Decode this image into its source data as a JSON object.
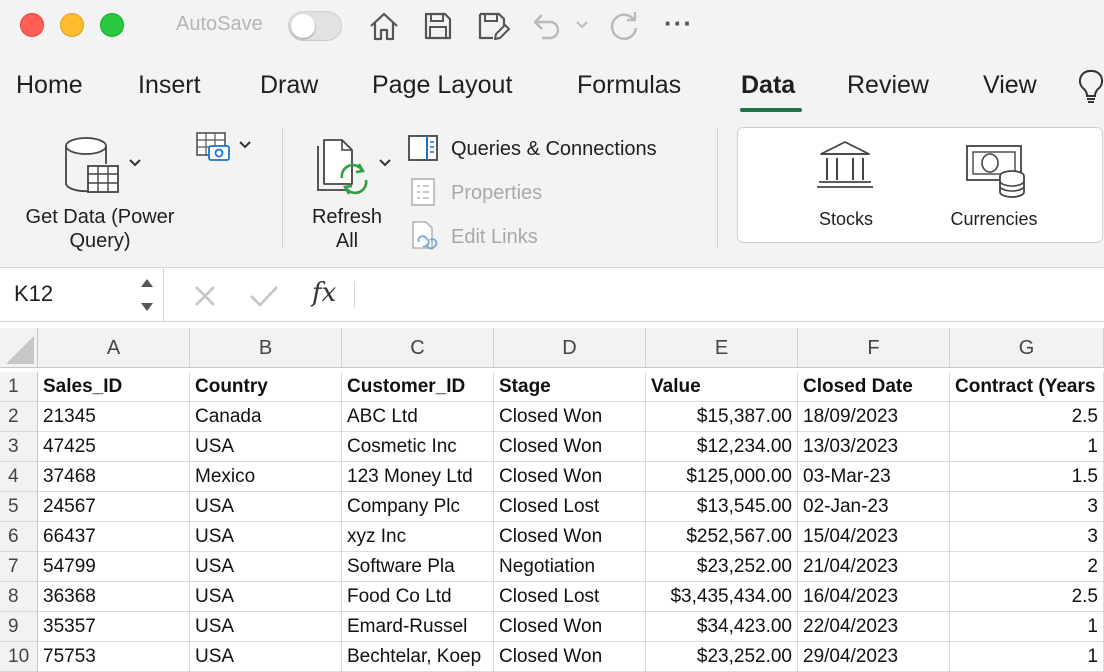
{
  "title_bar": {
    "autosave_label": "AutoSave",
    "autosave_on": false,
    "traffic_lights": {
      "close": "#ff5f57",
      "minimize": "#febc2e",
      "zoom": "#28c840"
    },
    "icons": [
      "home-icon",
      "save-icon",
      "save-as-icon",
      "undo-icon",
      "redo-icon",
      "more-icon"
    ],
    "more_label": "···"
  },
  "tabs": [
    {
      "label": "Home",
      "active": false
    },
    {
      "label": "Insert",
      "active": false
    },
    {
      "label": "Draw",
      "active": false
    },
    {
      "label": "Page Layout",
      "active": false
    },
    {
      "label": "Formulas",
      "active": false
    },
    {
      "label": "Data",
      "active": true
    },
    {
      "label": "Review",
      "active": false
    },
    {
      "label": "View",
      "active": false
    }
  ],
  "tell_me_icon": "lightbulb-icon",
  "accent_color": "#1e7145",
  "ribbon": {
    "get_data": {
      "line1": "Get Data (Power",
      "line2": "Query)"
    },
    "refresh": {
      "line1": "Refresh",
      "line2": "All"
    },
    "queries_connections": "Queries & Connections",
    "properties": "Properties",
    "edit_links": "Edit Links",
    "stocks": "Stocks",
    "currencies": "Currencies"
  },
  "formula_bar": {
    "name_box": "K12",
    "fx_label": "fx",
    "formula": ""
  },
  "grid": {
    "columns": [
      "A",
      "B",
      "C",
      "D",
      "E",
      "F",
      "G"
    ],
    "rows": [
      {
        "n": "1",
        "cells": [
          "Sales_ID",
          "Country",
          "Customer_ID",
          "Stage",
          "Value",
          "Closed Date",
          "Contract (Years"
        ]
      },
      {
        "n": "2",
        "cells": [
          "21345",
          "Canada",
          "ABC Ltd",
          "Closed Won",
          "$15,387.00",
          "18/09/2023",
          "2.5"
        ]
      },
      {
        "n": "3",
        "cells": [
          "47425",
          "USA",
          "Cosmetic Inc",
          "Closed Won",
          "$12,234.00",
          "13/03/2023",
          "1"
        ]
      },
      {
        "n": "4",
        "cells": [
          "37468",
          "Mexico",
          "123 Money Ltd",
          "Closed Won",
          "$125,000.00",
          "03-Mar-23",
          "1.5"
        ]
      },
      {
        "n": "5",
        "cells": [
          "24567",
          "USA",
          "Company Plc",
          "Closed Lost",
          "$13,545.00",
          "02-Jan-23",
          "3"
        ]
      },
      {
        "n": "6",
        "cells": [
          "66437",
          "USA",
          "xyz Inc",
          "Closed Won",
          "$252,567.00",
          "15/04/2023",
          "3"
        ]
      },
      {
        "n": "7",
        "cells": [
          "54799",
          "USA",
          "Software Pla",
          "Negotiation",
          "$23,252.00",
          "21/04/2023",
          "2"
        ]
      },
      {
        "n": "8",
        "cells": [
          "36368",
          "USA",
          "Food Co Ltd",
          "Closed Lost",
          "$3,435,434.00",
          "16/04/2023",
          "2.5"
        ]
      },
      {
        "n": "9",
        "cells": [
          "35357",
          "USA",
          "Emard-Russel",
          "Closed Won",
          "$34,423.00",
          "22/04/2023",
          "1"
        ]
      },
      {
        "n": "10",
        "cells": [
          "75753",
          "USA",
          "Bechtelar, Koep",
          "Closed Won",
          "$23,252.00",
          "29/04/2023",
          "1"
        ]
      }
    ]
  }
}
